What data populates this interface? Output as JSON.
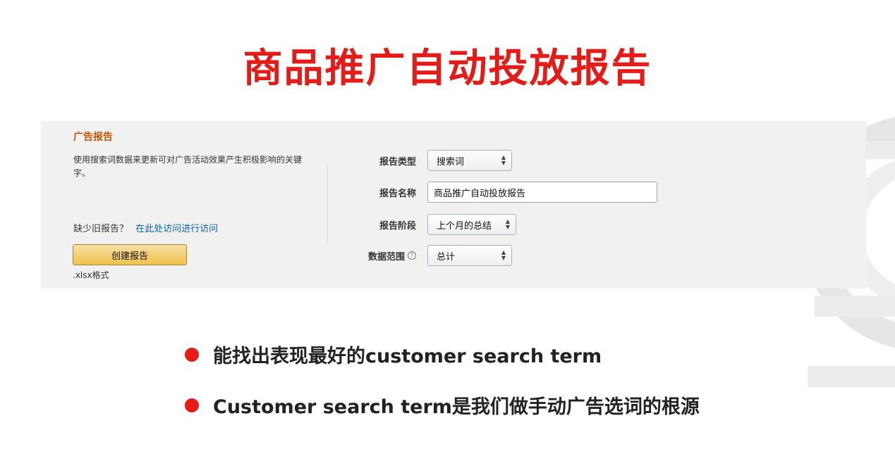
{
  "slide": {
    "title": "商品推广自动投放报告",
    "accent_color": "#e41b17",
    "bullets": [
      "能找出表现最好的customer search term",
      "Customer search term是我们做手动广告选词的根源"
    ]
  },
  "report_panel": {
    "heading": "广告报告",
    "description": "使用搜索词数据来更新可对广告活动效果产生积极影响的关键字。",
    "missing_prefix": "缺少旧报告？",
    "missing_link": "在此处访问进行访问",
    "create_button": "创建报告",
    "format_note": ".xlsx格式",
    "form": {
      "report_type": {
        "label": "报告类型",
        "value": "搜索词"
      },
      "report_name": {
        "label": "报告名称",
        "value": "商品推广自动投放报告"
      },
      "report_period": {
        "label": "报告阶段",
        "value": "上个月的总结"
      },
      "data_range": {
        "label": "数据范围",
        "value": "总计",
        "help_icon": "?"
      }
    }
  }
}
